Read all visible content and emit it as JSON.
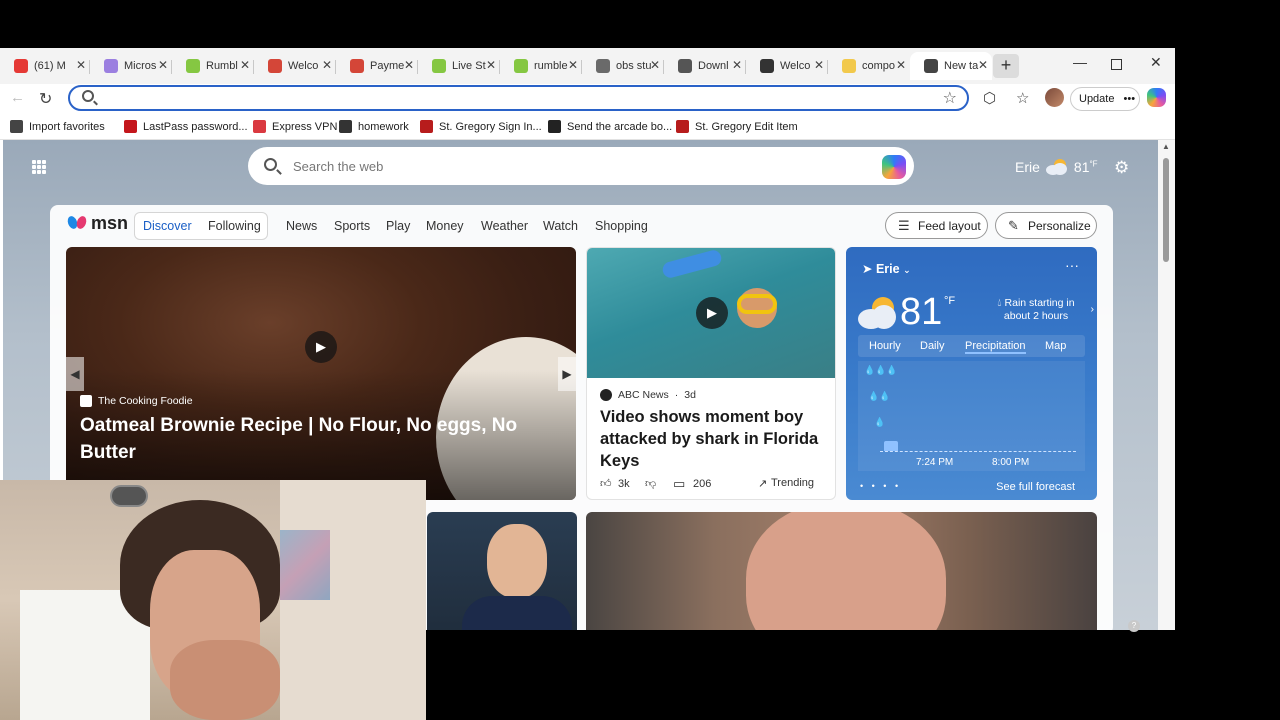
{
  "tabs": [
    {
      "label": "(61) M",
      "favicon": "youtube-icon",
      "color": "#e53935"
    },
    {
      "label": "Micros",
      "favicon": "microsoft-icon",
      "color": "#9b7fe0"
    },
    {
      "label": "Rumbl",
      "favicon": "rumble-icon",
      "color": "#85c742"
    },
    {
      "label": "Welco",
      "favicon": "gmail-icon",
      "color": "#d44638"
    },
    {
      "label": "Payme",
      "favicon": "gmail-icon",
      "color": "#d44638"
    },
    {
      "label": "Live St",
      "favicon": "rumble-icon",
      "color": "#85c742"
    },
    {
      "label": "rumble",
      "favicon": "rumble-icon",
      "color": "#85c742"
    },
    {
      "label": "obs stu",
      "favicon": "search-icon",
      "color": "#6a6a6a"
    },
    {
      "label": "Downl",
      "favicon": "obs-icon",
      "color": "#555555"
    },
    {
      "label": "Welco",
      "favicon": "globe-icon",
      "color": "#333333"
    },
    {
      "label": "compo",
      "favicon": "folder-icon",
      "color": "#f2c94c"
    },
    {
      "label": "New ta",
      "favicon": "newtab-icon",
      "color": "#444444",
      "active": true
    }
  ],
  "toolbar": {
    "address_placeholder": "",
    "update_label": "Update"
  },
  "favorites": [
    {
      "label": "Import favorites",
      "icon": "import-icon",
      "color": "#444444"
    },
    {
      "label": "LastPass password...",
      "icon": "lastpass-icon",
      "color": "#c4161c"
    },
    {
      "label": "Express VPN",
      "icon": "expressvpn-icon",
      "color": "#da3940"
    },
    {
      "label": "homework",
      "icon": "globe-icon",
      "color": "#333333"
    },
    {
      "label": "St. Gregory Sign In...",
      "icon": "stgregory-icon",
      "color": "#b71c1c"
    },
    {
      "label": "Send the arcade bo...",
      "icon": "arcade-icon",
      "color": "#222222"
    },
    {
      "label": "St. Gregory Edit Item",
      "icon": "stgregory-icon",
      "color": "#b71c1c"
    }
  ],
  "newtab": {
    "search_placeholder": "Search the web",
    "weather_city": "Erie",
    "weather_temp": "81",
    "weather_unit": "°F"
  },
  "feed": {
    "brand": "msn",
    "nav": [
      {
        "label": "Discover",
        "active": true
      },
      {
        "label": "Following"
      },
      {
        "label": "News"
      },
      {
        "label": "Sports"
      },
      {
        "label": "Play"
      },
      {
        "label": "Money"
      },
      {
        "label": "Weather"
      },
      {
        "label": "Watch"
      },
      {
        "label": "Shopping"
      }
    ],
    "feed_layout_label": "Feed layout",
    "personalize_label": "Personalize"
  },
  "cards": {
    "brownie": {
      "source": "The Cooking Foodie",
      "title": "Oatmeal Brownie Recipe | No Flour, No eggs, No Butter"
    },
    "shark": {
      "source": "ABC News",
      "age": "3d",
      "title": "Video shows moment boy attacked by shark in Florida Keys",
      "likes": "3k",
      "comments": "206",
      "trending_label": "Trending"
    }
  },
  "weather_card": {
    "city": "Erie",
    "temp": "81",
    "unit": "°F",
    "summary": "Rain starting in about 2 hours",
    "tabs": [
      "Hourly",
      "Daily",
      "Precipitation",
      "Map"
    ],
    "active_tab": "Precipitation",
    "times": [
      "7:24 PM",
      "8:00 PM"
    ],
    "footer": "See full forecast"
  }
}
